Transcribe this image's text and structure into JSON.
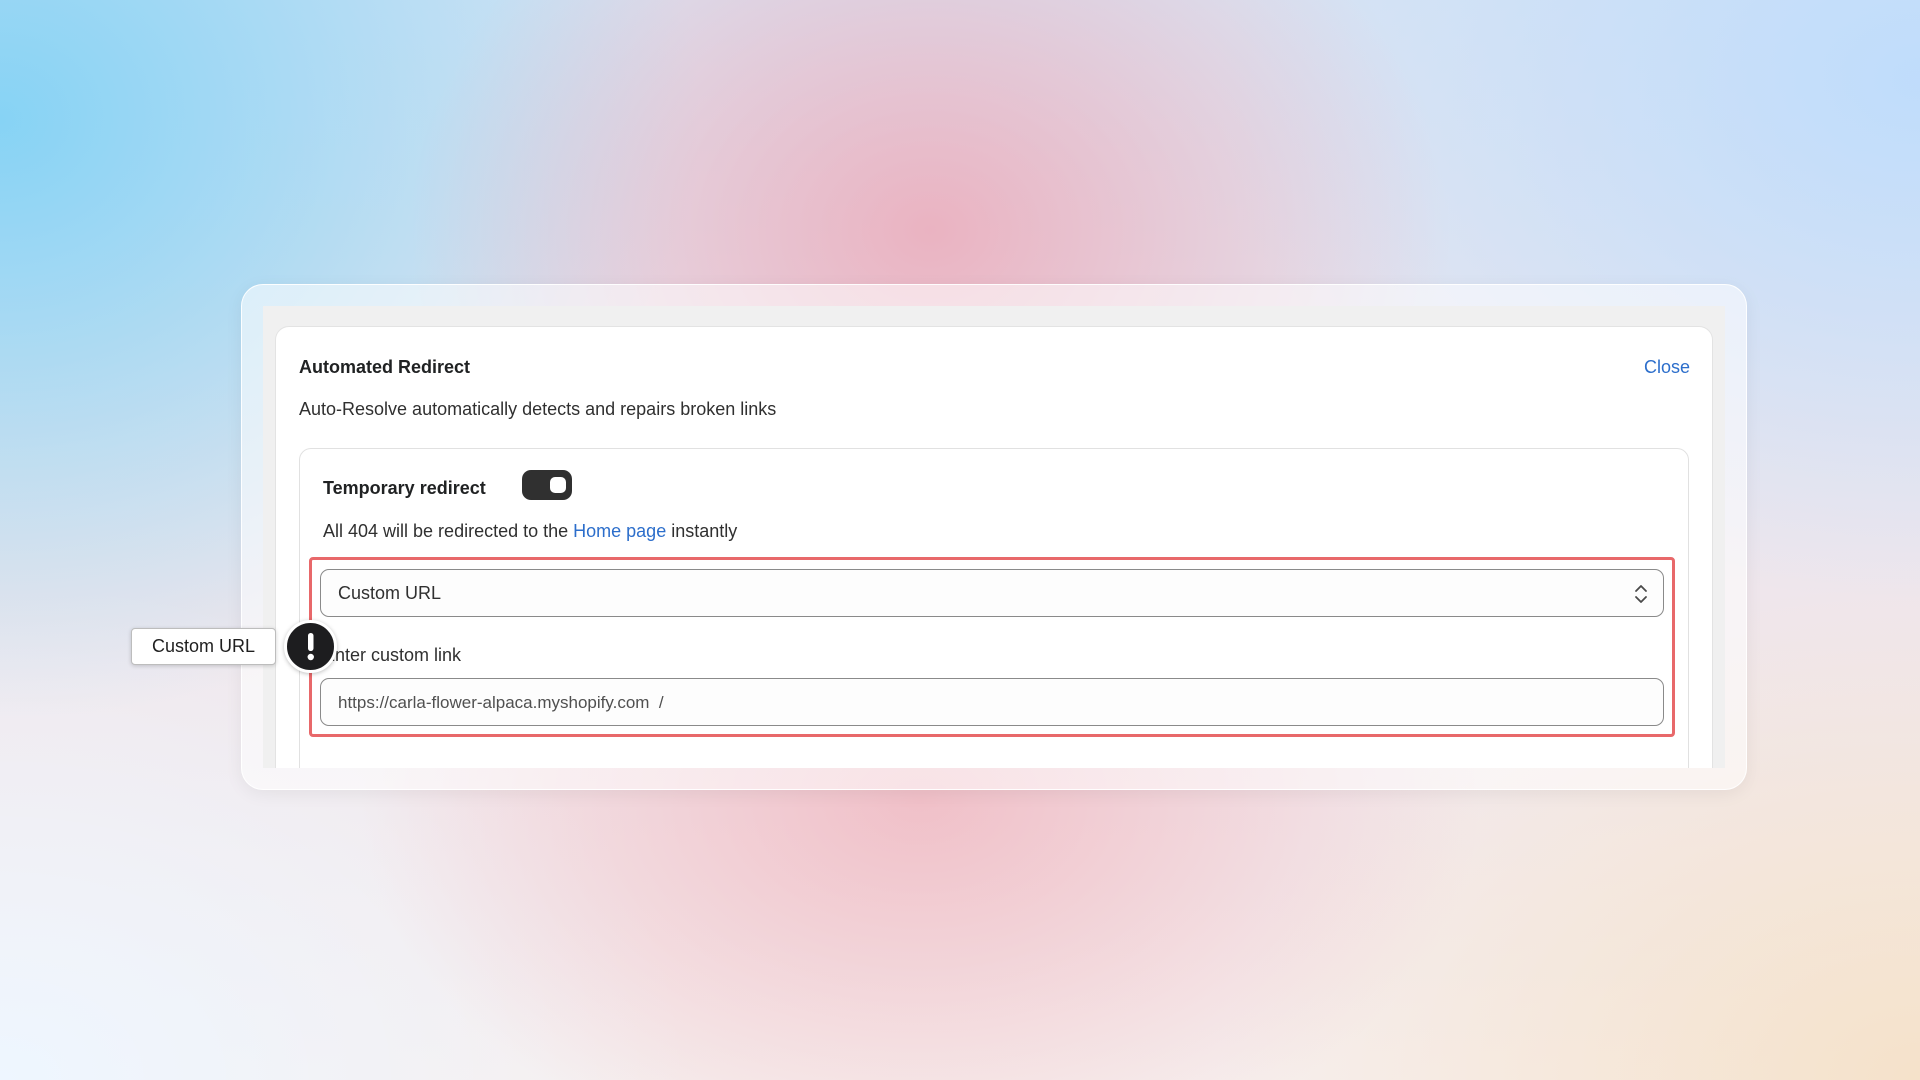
{
  "modal": {
    "title": "Automated Redirect",
    "close_label": "Close",
    "subtitle": "Auto-Resolve automatically detects and repairs broken links"
  },
  "redirect_card": {
    "title": "Temporary redirect",
    "toggle_on": true,
    "description_prefix": "All 404 will be redirected to the ",
    "description_link": "Home page",
    "description_suffix": " instantly",
    "select_value": "Custom URL",
    "custom_link_label": "Enter custom link",
    "url_value": "https://carla-flower-alpaca.myshopify.com  /"
  },
  "annotation": {
    "tooltip_label": "Custom URL",
    "icon": "exclamation-icon"
  },
  "colors": {
    "accent_link": "#2c6ecb",
    "highlight_border": "#e8686a",
    "toggle_bg": "#303030"
  }
}
